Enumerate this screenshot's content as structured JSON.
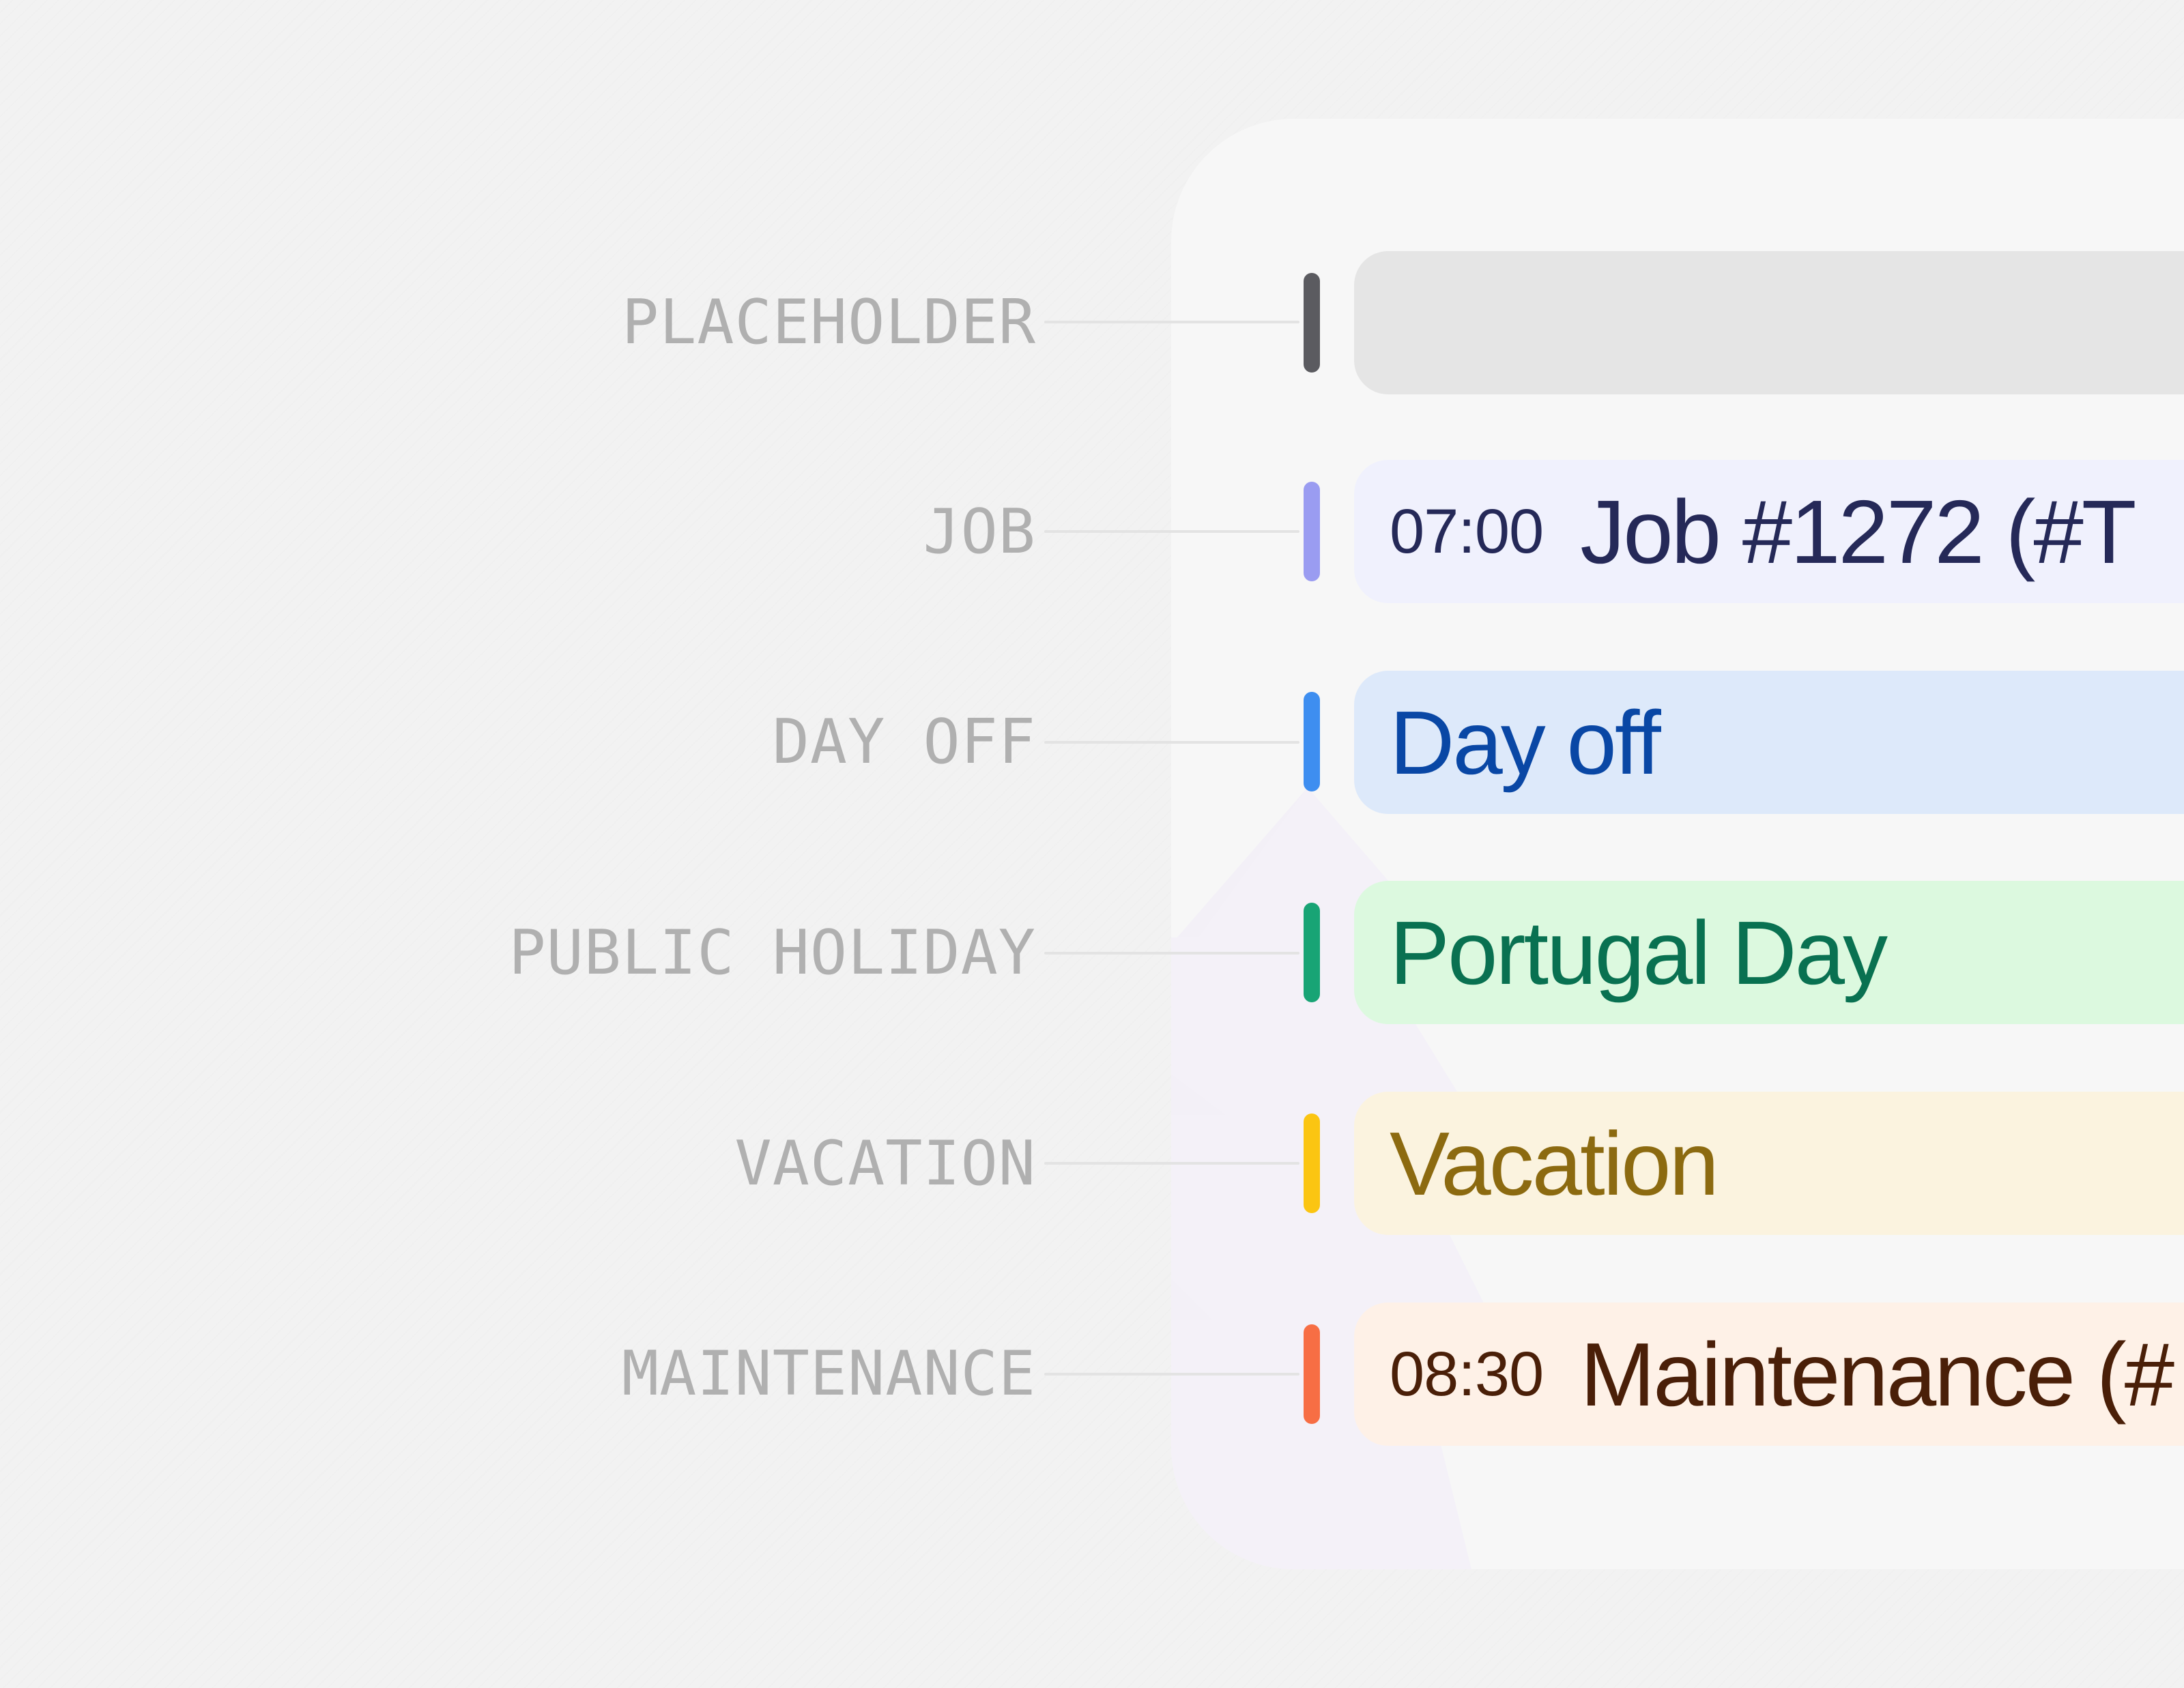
{
  "rows": [
    {
      "key": "placeholder",
      "label": "PLACEHOLDER",
      "time": "",
      "title": "",
      "marker_color": "#5b5b60",
      "bg_color": "#e5e5e5",
      "text_color": "#333333"
    },
    {
      "key": "job",
      "label": "JOB",
      "time": "07:00",
      "title": "Job #1272 (#T",
      "marker_color": "#9a9cf1",
      "bg_color": "#f0f1fd",
      "text_color": "#252958"
    },
    {
      "key": "day-off",
      "label": "DAY OFF",
      "time": "",
      "title": "Day off",
      "marker_color": "#3e8ef0",
      "bg_color": "#dde9fa",
      "text_color": "#0947a5"
    },
    {
      "key": "public-holiday",
      "label": "PUBLIC HOLIDAY",
      "time": "",
      "title": "Portugal Day",
      "marker_color": "#18a475",
      "bg_color": "#dcf9df",
      "text_color": "#097151"
    },
    {
      "key": "vacation",
      "label": "VACATION",
      "time": "",
      "title": "Vacation",
      "marker_color": "#fbc512",
      "bg_color": "#fbf3df",
      "text_color": "#8c6a10"
    },
    {
      "key": "maintenance",
      "label": "MAINTENANCE",
      "time": "08:30",
      "title": "Maintenance (#",
      "marker_color": "#f76e44",
      "bg_color": "#fef1e7",
      "text_color": "#4a1f08"
    }
  ]
}
